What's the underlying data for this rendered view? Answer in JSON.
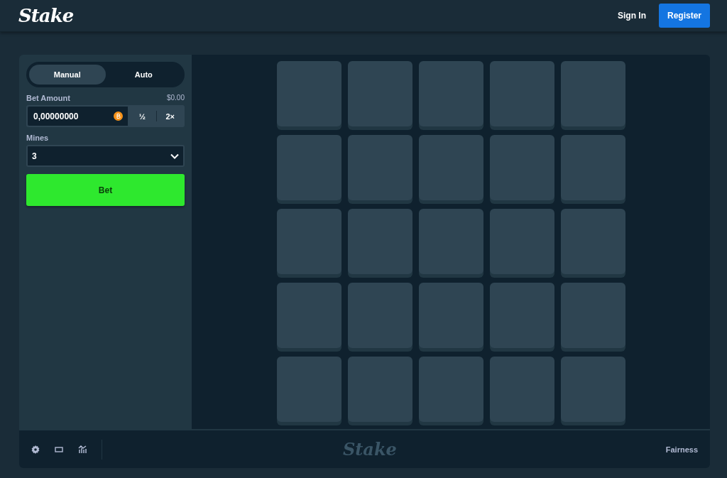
{
  "header": {
    "logo": "Stake",
    "sign_in": "Sign In",
    "register": "Register"
  },
  "sidebar": {
    "modes": [
      {
        "label": "Manual",
        "selected": true
      },
      {
        "label": "Auto",
        "selected": false
      }
    ],
    "bet_amount": {
      "label": "Bet Amount",
      "fiat": "$0.00",
      "value": "0,00000000",
      "half": "½",
      "double": "2×"
    },
    "mines": {
      "label": "Mines",
      "value": "3"
    },
    "bet_button": "Bet"
  },
  "tiles": [
    {
      "revealed": false
    },
    {
      "revealed": false
    },
    {
      "revealed": false
    },
    {
      "revealed": false
    },
    {
      "revealed": false
    },
    {
      "revealed": false
    },
    {
      "revealed": false
    },
    {
      "revealed": false
    },
    {
      "revealed": false
    },
    {
      "revealed": false
    },
    {
      "revealed": false
    },
    {
      "revealed": false
    },
    {
      "revealed": false
    },
    {
      "revealed": false
    },
    {
      "revealed": false
    },
    {
      "revealed": false
    },
    {
      "revealed": false
    },
    {
      "revealed": false
    },
    {
      "revealed": false
    },
    {
      "revealed": false
    },
    {
      "revealed": false
    },
    {
      "revealed": false
    },
    {
      "revealed": false
    },
    {
      "revealed": false
    },
    {
      "revealed": false
    }
  ],
  "footer": {
    "logo": "Stake",
    "fairness": "Fairness"
  }
}
